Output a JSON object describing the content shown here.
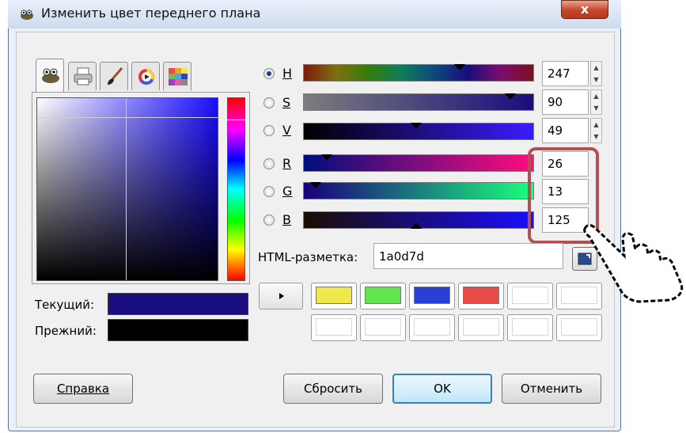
{
  "window": {
    "title": "Изменить цвет переднего плана",
    "close_label": "x"
  },
  "tabs": [
    {
      "name": "gimp",
      "icon": "gimp-wilber-icon"
    },
    {
      "name": "printer",
      "icon": "printer-icon"
    },
    {
      "name": "brush",
      "icon": "paintbrush-icon"
    },
    {
      "name": "wheel",
      "icon": "color-wheel-icon"
    },
    {
      "name": "palette",
      "icon": "palette-grid-icon"
    }
  ],
  "current": {
    "label": "Текущий:",
    "color": "#1a0d7d"
  },
  "previous": {
    "label": "Прежний:",
    "color": "#000000"
  },
  "channels": [
    {
      "key": "h",
      "label": "H",
      "value": "247",
      "fraction": 0.68,
      "selected": true,
      "gradient": "linear-gradient(to right,#7d1a0d,#7d700d,#327d0d,#0d7d5a,#0d487d,#1a0d7d,#7d0d6e,#7d0d1a)",
      "thumb_pos": "top",
      "has_spin": true
    },
    {
      "key": "s",
      "label": "S",
      "value": "90",
      "fraction": 0.9,
      "selected": false,
      "gradient": "linear-gradient(to right,#7d7d7d,#1a0d7d)",
      "thumb_pos": "top",
      "has_spin": true
    },
    {
      "key": "v",
      "label": "V",
      "value": "49",
      "fraction": 0.49,
      "selected": false,
      "gradient": "linear-gradient(to right,#000000,#3a1cff)",
      "thumb_pos": "top",
      "has_spin": true
    },
    {
      "key": "r",
      "label": "R",
      "value": "26",
      "fraction": 0.1,
      "selected": false,
      "gradient": "linear-gradient(to right,#000d7d,#ff0d7d)",
      "thumb_pos": "top",
      "has_spin": false
    },
    {
      "key": "g",
      "label": "G",
      "value": "13",
      "fraction": 0.05,
      "selected": false,
      "gradient": "linear-gradient(to right,#1a007d,#1aff7d)",
      "thumb_pos": "top",
      "has_spin": false
    },
    {
      "key": "b",
      "label": "B",
      "value": "125",
      "fraction": 0.49,
      "selected": false,
      "gradient": "linear-gradient(to right,#1a0d00,#1a0dff)",
      "thumb_pos": "bottom",
      "has_spin": false
    }
  ],
  "html_notation": {
    "label": "HTML-разметка:",
    "value": "1a0d7d"
  },
  "history_colors": [
    "#f0e84a",
    "#63e54e",
    "#2a3fd6",
    "#e84a46",
    "#ffffff",
    "#ffffff",
    "#ffffff",
    "#ffffff",
    "#ffffff",
    "#ffffff",
    "#ffffff",
    "#ffffff"
  ],
  "buttons": {
    "help": "Справка",
    "reset": "Сбросить",
    "ok": "OK",
    "cancel": "Отменить"
  }
}
